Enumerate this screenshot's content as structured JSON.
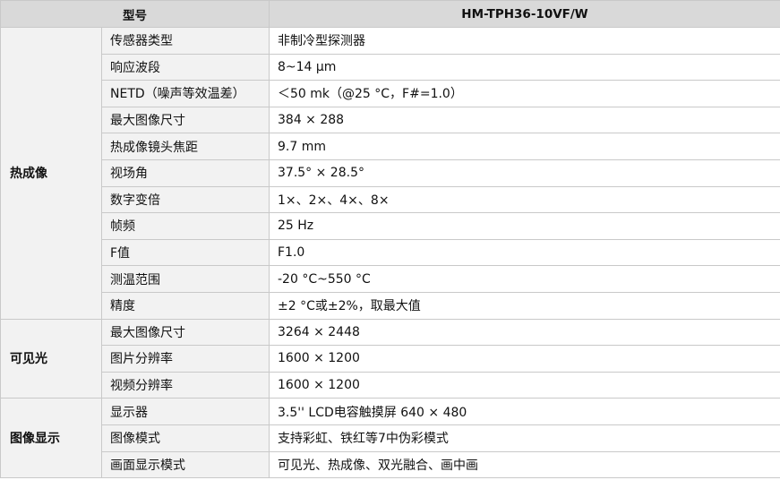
{
  "header": {
    "label": "型号",
    "model": "HM-TPH36-10VF/W"
  },
  "sections": [
    {
      "category": "热成像",
      "rows": [
        {
          "param": "传感器类型",
          "value": "非制冷型探测器"
        },
        {
          "param": "响应波段",
          "value": "8~14 μm"
        },
        {
          "param": "NETD（噪声等效温差）",
          "value": "＜50 mk（@25 °C，F#=1.0）"
        },
        {
          "param": "最大图像尺寸",
          "value": "384 × 288"
        },
        {
          "param": "热成像镜头焦距",
          "value": "9.7 mm"
        },
        {
          "param": "视场角",
          "value": "37.5° × 28.5°"
        },
        {
          "param": "数字变倍",
          "value": "1×、2×、4×、8×"
        },
        {
          "param": "帧频",
          "value": "25 Hz"
        },
        {
          "param": "F值",
          "value": "F1.0"
        },
        {
          "param": "测温范围",
          "value": "-20 °C~550 °C"
        },
        {
          "param": "精度",
          "value": "±2 °C或±2%，取最大值"
        }
      ]
    },
    {
      "category": "可见光",
      "rows": [
        {
          "param": "最大图像尺寸",
          "value": "3264 × 2448"
        },
        {
          "param": "图片分辨率",
          "value": "1600 × 1200"
        },
        {
          "param": "视频分辨率",
          "value": "1600 × 1200"
        }
      ]
    },
    {
      "category": "图像显示",
      "rows": [
        {
          "param": "显示器",
          "value": "3.5'' LCD电容触摸屏  640 × 480"
        },
        {
          "param": "图像模式",
          "value": "支持彩虹、铁红等7中伪彩模式"
        },
        {
          "param": "画面显示模式",
          "value": "可见光、热成像、双光融合、画中画"
        }
      ]
    }
  ]
}
